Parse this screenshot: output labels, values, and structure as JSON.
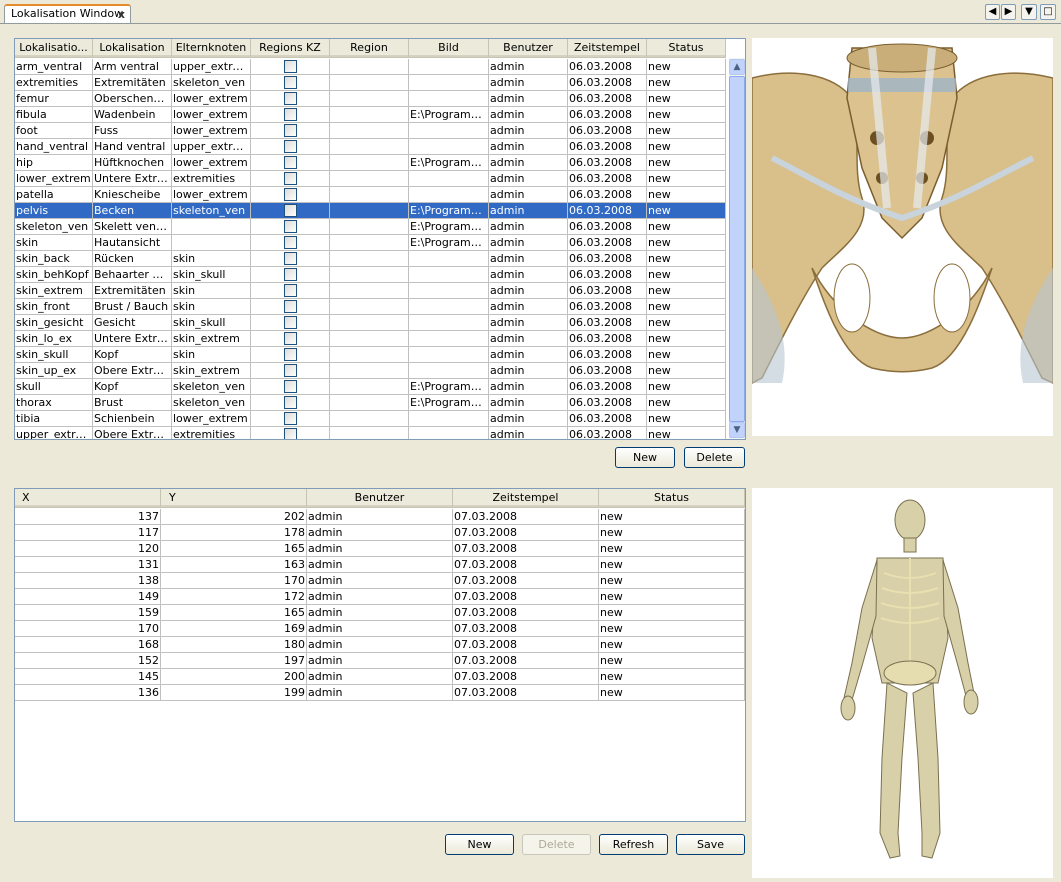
{
  "window": {
    "tab_title": "Lokalisation Window",
    "tab_close": "x",
    "controls": [
      "◀",
      "▶",
      "▼",
      "□"
    ]
  },
  "top_table": {
    "columns": [
      "Lokalisatio...",
      "Lokalisation",
      "Elternknoten",
      "Regions KZ",
      "Region",
      "Bild",
      "Benutzer",
      "Zeitstempel",
      "Status"
    ],
    "selected_row": 9,
    "rows": [
      [
        "arm_ventral",
        "Arm ventral",
        "upper_extrem",
        "",
        "",
        "",
        "admin",
        "06.03.2008",
        "new"
      ],
      [
        "extremities",
        "Extremitäten",
        "skeleton_ven",
        "",
        "",
        "",
        "admin",
        "06.03.2008",
        "new"
      ],
      [
        "femur",
        "Oberschenke...",
        "lower_extrem",
        "",
        "",
        "",
        "admin",
        "06.03.2008",
        "new"
      ],
      [
        "fibula",
        "Wadenbein",
        "lower_extrem",
        "",
        "",
        "E:\\Programmi...",
        "admin",
        "06.03.2008",
        "new"
      ],
      [
        "foot",
        "Fuss",
        "lower_extrem",
        "",
        "",
        "",
        "admin",
        "06.03.2008",
        "new"
      ],
      [
        "hand_ventral",
        "Hand ventral",
        "upper_extrem",
        "",
        "",
        "",
        "admin",
        "06.03.2008",
        "new"
      ],
      [
        "hip",
        "Hüftknochen",
        "lower_extrem",
        "",
        "",
        "E:\\Programmi...",
        "admin",
        "06.03.2008",
        "new"
      ],
      [
        "lower_extrem",
        "Untere Extre...",
        "extremities",
        "",
        "",
        "",
        "admin",
        "06.03.2008",
        "new"
      ],
      [
        "patella",
        "Kniescheibe",
        "lower_extrem",
        "",
        "",
        "",
        "admin",
        "06.03.2008",
        "new"
      ],
      [
        "pelvis",
        "Becken",
        "skeleton_ven",
        "",
        "",
        "E:\\Programmi...",
        "admin",
        "06.03.2008",
        "new"
      ],
      [
        "skeleton_ven",
        "Skelett ventral",
        "",
        "",
        "",
        "E:\\Programmi...",
        "admin",
        "06.03.2008",
        "new"
      ],
      [
        "skin",
        "Hautansicht",
        "",
        "",
        "",
        "E:\\Programmi...",
        "admin",
        "06.03.2008",
        "new"
      ],
      [
        "skin_back",
        "Rücken",
        "skin",
        "",
        "",
        "",
        "admin",
        "06.03.2008",
        "new"
      ],
      [
        "skin_behKopf",
        "Behaarter Kopf",
        "skin_skull",
        "",
        "",
        "",
        "admin",
        "06.03.2008",
        "new"
      ],
      [
        "skin_extrem",
        "Extremitäten",
        "skin",
        "",
        "",
        "",
        "admin",
        "06.03.2008",
        "new"
      ],
      [
        "skin_front",
        "Brust / Bauch",
        "skin",
        "",
        "",
        "",
        "admin",
        "06.03.2008",
        "new"
      ],
      [
        "skin_gesicht",
        "Gesicht",
        "skin_skull",
        "",
        "",
        "",
        "admin",
        "06.03.2008",
        "new"
      ],
      [
        "skin_lo_ex",
        "Untere Extre...",
        "skin_extrem",
        "",
        "",
        "",
        "admin",
        "06.03.2008",
        "new"
      ],
      [
        "skin_skull",
        "Kopf",
        "skin",
        "",
        "",
        "",
        "admin",
        "06.03.2008",
        "new"
      ],
      [
        "skin_up_ex",
        "Obere Extre...",
        "skin_extrem",
        "",
        "",
        "",
        "admin",
        "06.03.2008",
        "new"
      ],
      [
        "skull",
        "Kopf",
        "skeleton_ven",
        "",
        "",
        "E:\\Programmi...",
        "admin",
        "06.03.2008",
        "new"
      ],
      [
        "thorax",
        "Brust",
        "skeleton_ven",
        "",
        "",
        "E:\\Programmi...",
        "admin",
        "06.03.2008",
        "new"
      ],
      [
        "tibia",
        "Schienbein",
        "lower_extrem",
        "",
        "",
        "",
        "admin",
        "06.03.2008",
        "new"
      ],
      [
        "upper_extrem",
        "Obere Extre...",
        "extremities",
        "",
        "",
        "",
        "admin",
        "06.03.2008",
        "new"
      ]
    ],
    "buttons": {
      "new": "New",
      "delete": "Delete"
    }
  },
  "bottom_table": {
    "columns": [
      "X",
      "Y",
      "Benutzer",
      "Zeitstempel",
      "Status"
    ],
    "rows": [
      [
        "137",
        "202",
        "admin",
        "07.03.2008",
        "new"
      ],
      [
        "117",
        "178",
        "admin",
        "07.03.2008",
        "new"
      ],
      [
        "120",
        "165",
        "admin",
        "07.03.2008",
        "new"
      ],
      [
        "131",
        "163",
        "admin",
        "07.03.2008",
        "new"
      ],
      [
        "138",
        "170",
        "admin",
        "07.03.2008",
        "new"
      ],
      [
        "149",
        "172",
        "admin",
        "07.03.2008",
        "new"
      ],
      [
        "159",
        "165",
        "admin",
        "07.03.2008",
        "new"
      ],
      [
        "170",
        "169",
        "admin",
        "07.03.2008",
        "new"
      ],
      [
        "168",
        "180",
        "admin",
        "07.03.2008",
        "new"
      ],
      [
        "152",
        "197",
        "admin",
        "07.03.2008",
        "new"
      ],
      [
        "145",
        "200",
        "admin",
        "07.03.2008",
        "new"
      ],
      [
        "136",
        "199",
        "admin",
        "07.03.2008",
        "new"
      ]
    ],
    "buttons": {
      "new": "New",
      "delete": "Delete",
      "refresh": "Refresh",
      "save": "Save"
    }
  },
  "images": {
    "top": "pelvis-anatomy-image",
    "bottom": "full-body-skeleton-image"
  },
  "colors": {
    "selection": "#316ac5",
    "tab_accent": "#e68b2c",
    "bone": "#d9bf8a"
  }
}
